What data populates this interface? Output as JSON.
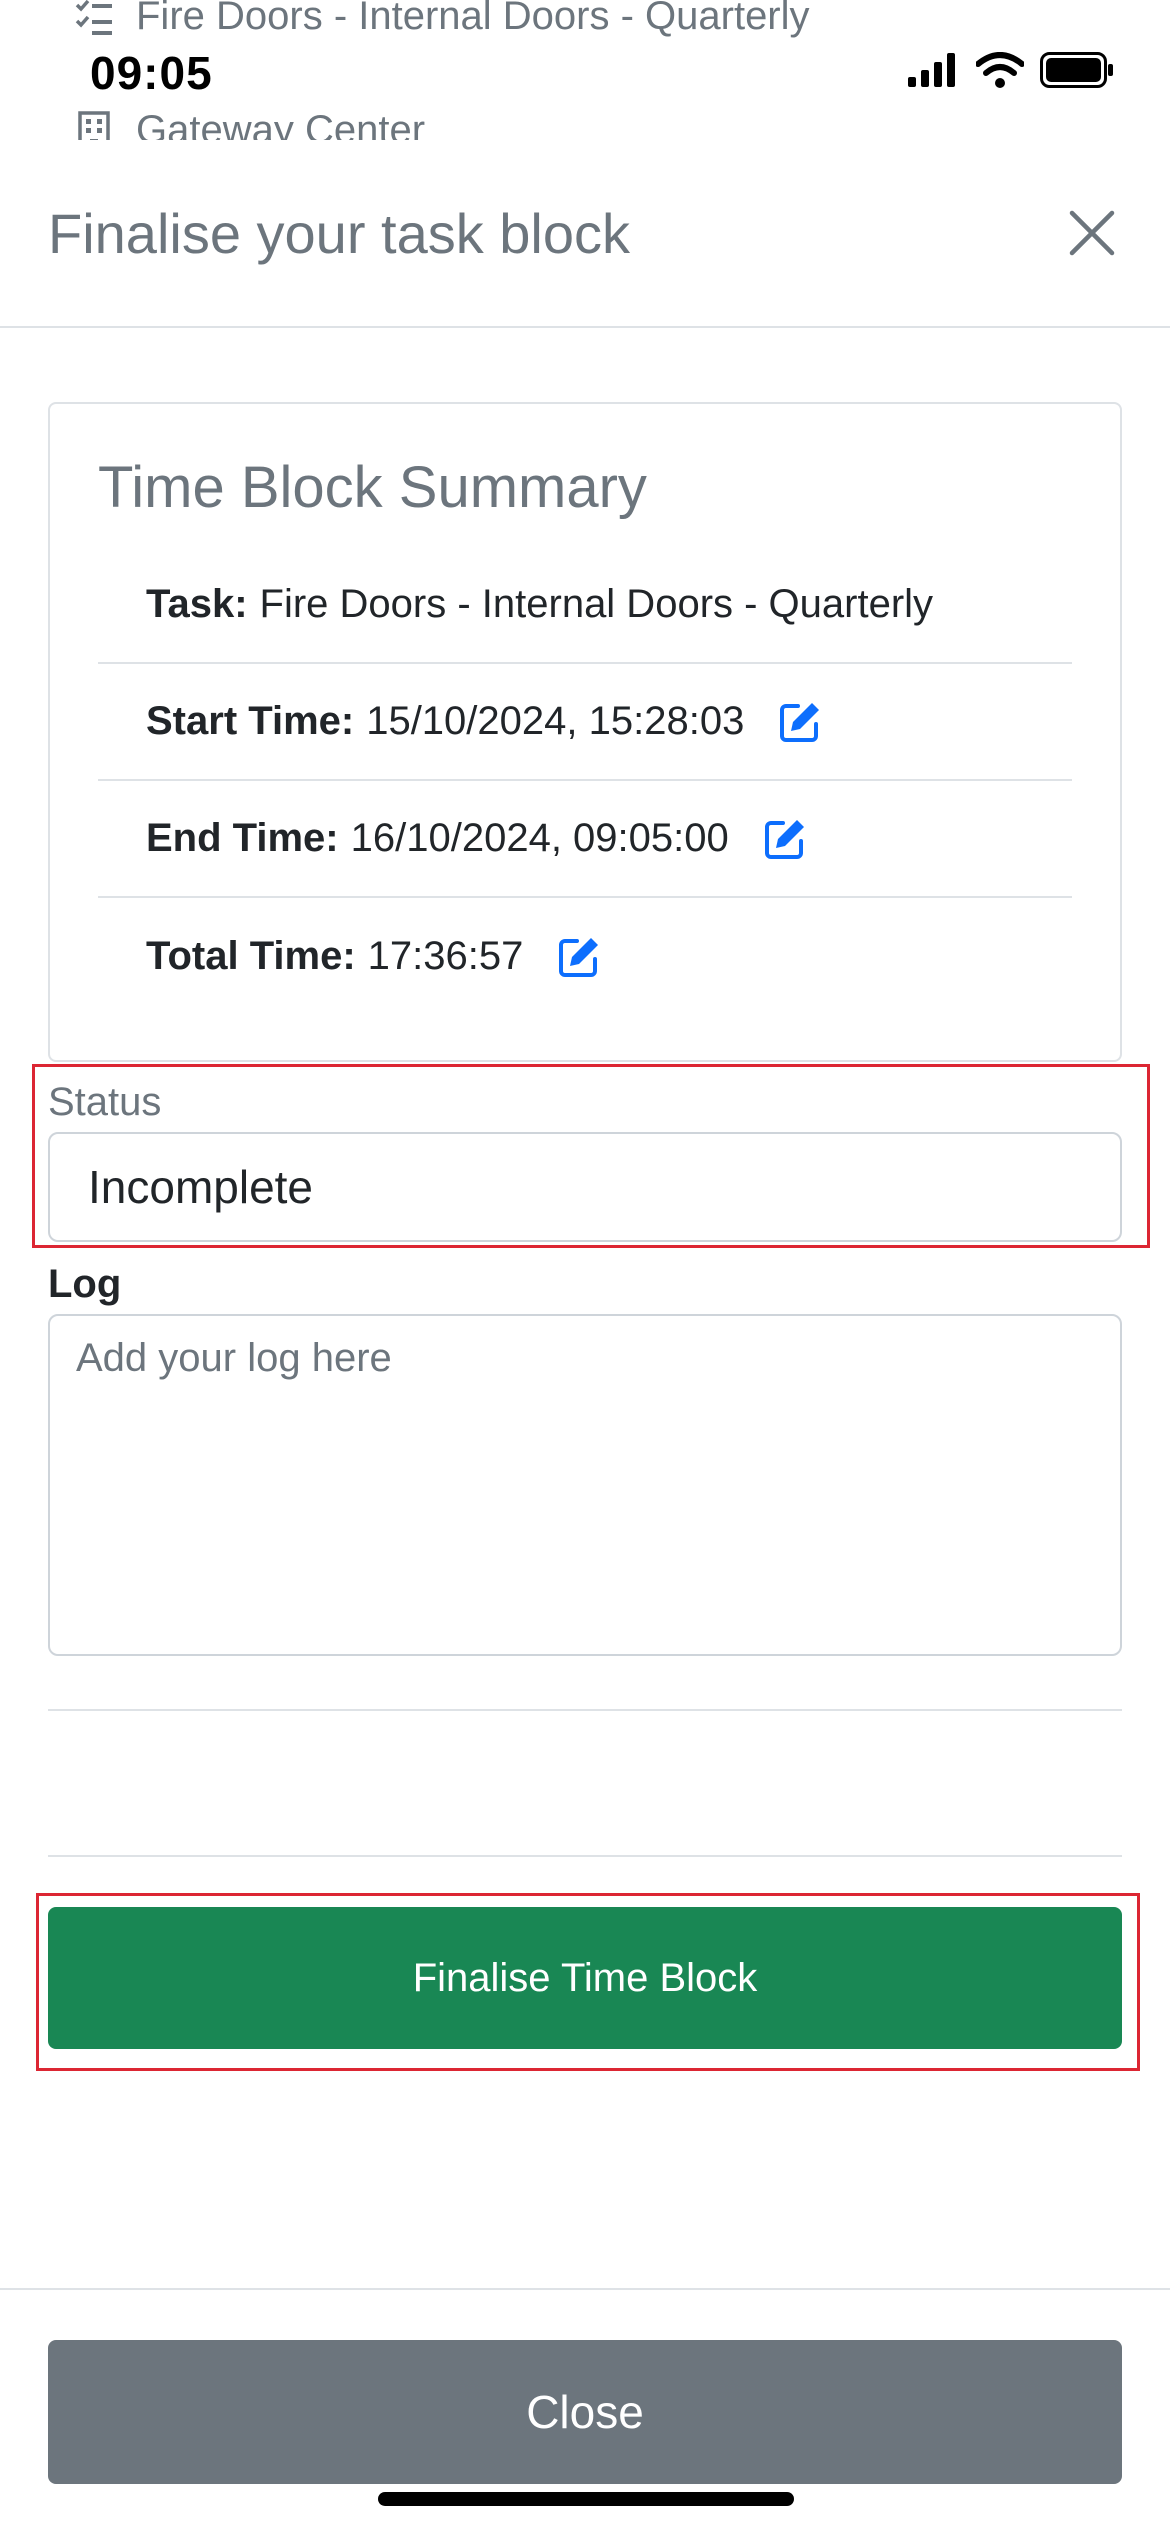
{
  "status_bar": {
    "time": "09:05"
  },
  "background": {
    "task_name": "Fire Doors - Internal Doors - Quarterly",
    "site_name": "Gateway Center"
  },
  "modal": {
    "title": "Finalise your task block",
    "summary": {
      "title": "Time Block Summary",
      "items": [
        {
          "label": "Task:",
          "value": "Fire Doors - Internal Doors - Quarterly",
          "editable": false
        },
        {
          "label": "Start Time:",
          "value": "15/10/2024, 15:28:03",
          "editable": true
        },
        {
          "label": "End Time:",
          "value": "16/10/2024, 09:05:00",
          "editable": true
        },
        {
          "label": "Total Time:",
          "value": "17:36:57",
          "editable": true
        }
      ]
    },
    "status": {
      "label": "Status",
      "value": "Incomplete"
    },
    "log": {
      "label": "Log",
      "placeholder": "Add your log here",
      "value": ""
    },
    "finalise_label": "Finalise Time Block",
    "close_label": "Close"
  },
  "colors": {
    "primary": "#0d6efd",
    "success": "#198754",
    "secondary": "#6c757d",
    "highlight": "#dc2633"
  },
  "icons": [
    "list-check-icon",
    "building-icon",
    "close-icon",
    "edit-icon",
    "signal-icon",
    "wifi-icon",
    "battery-icon"
  ]
}
